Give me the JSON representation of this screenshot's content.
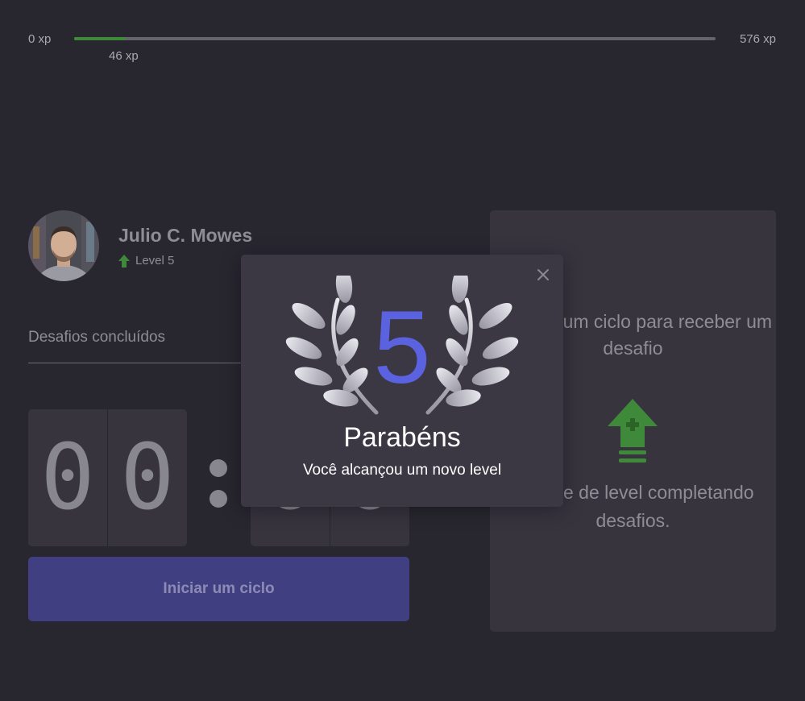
{
  "xp": {
    "min_label": "0 xp",
    "max_label": "576 xp",
    "current_label": "46 xp",
    "current": 46,
    "max": 576,
    "fill_color": "#3e8a3a"
  },
  "profile": {
    "name": "Julio C. Mowes",
    "level_label": "Level 5",
    "level_icon": "arrow-up-icon"
  },
  "challenges": {
    "label": "Desafios concluídos"
  },
  "countdown": {
    "minutes": [
      "0",
      "0"
    ],
    "seconds": [
      "0",
      "0"
    ]
  },
  "start_button_label": "Iniciar um ciclo",
  "challenge_panel": {
    "title": "Finalize um ciclo para receber um desafio",
    "icon": "level-up-icon",
    "hint": "Avance de level completando desafios."
  },
  "modal": {
    "level": "5",
    "title": "Parabéns",
    "subtitle": "Você alcançou um novo level",
    "close_icon": "close-icon",
    "accent_color": "#5b62e0"
  }
}
